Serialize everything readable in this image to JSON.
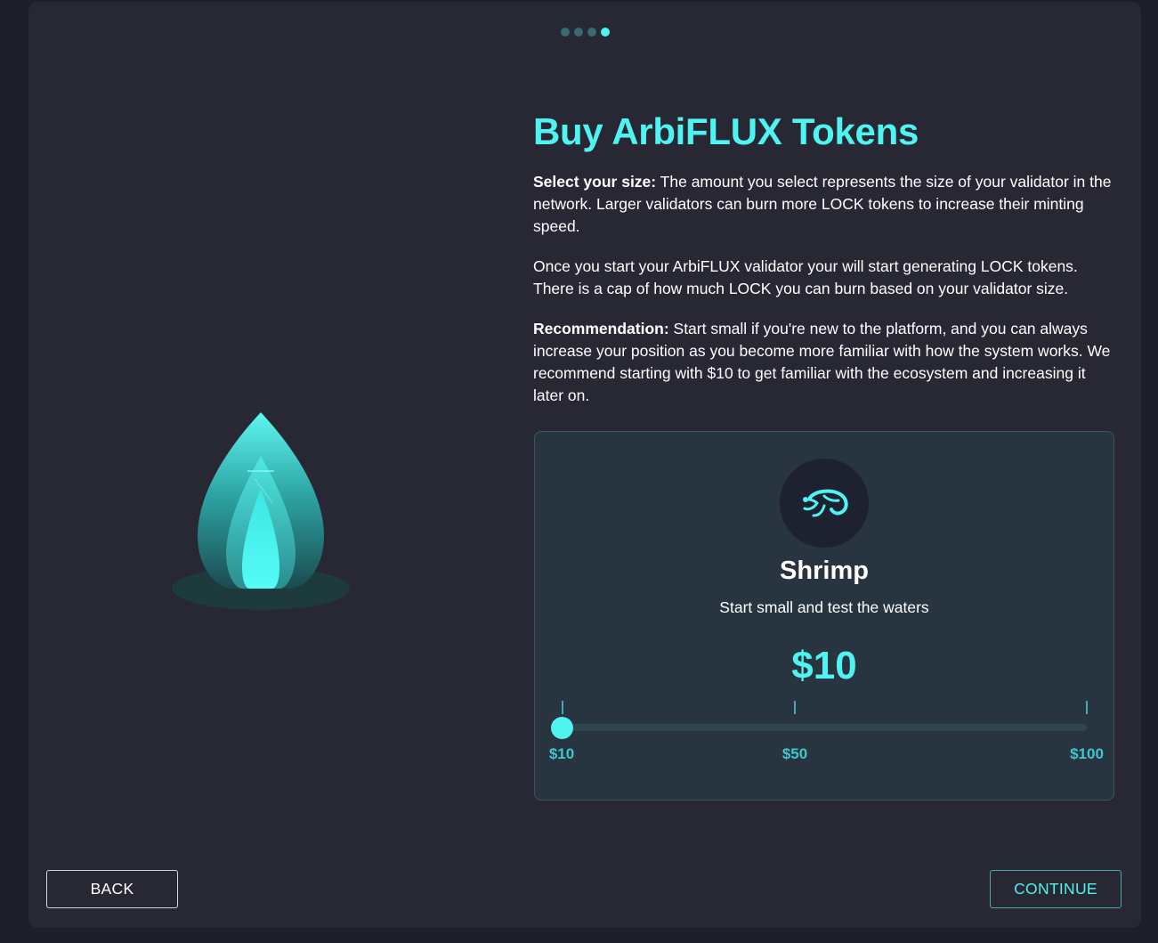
{
  "progress": {
    "total_steps": 4,
    "current_step": 4
  },
  "intro": {
    "title": "Buy ArbiFLUX Tokens",
    "size_label": "Select your size:",
    "size_text": " The amount you select represents the size of your validator in the network. Larger validators can burn more LOCK tokens to increase their minting speed.",
    "info_text": "Once you start your ArbiFLUX validator your will start generating LOCK tokens. There is a cap of how much LOCK you can burn based on your validator size.",
    "rec_label": "Recommendation:",
    "rec_text": " Start small if you're new to the platform, and you can always increase your position as you become more familiar with how the system works. We recommend starting with $10 to get familiar with the ecosystem and increasing it later on."
  },
  "tier": {
    "icon": "shrimp-icon",
    "name": "Shrimp",
    "description": "Start small and test the waters",
    "price": "$10"
  },
  "slider": {
    "min_label": "$10",
    "mid_label": "$50",
    "max_label": "$100",
    "value_fraction": 0
  },
  "buttons": {
    "back_label": "BACK",
    "continue_label": "CONTINUE"
  },
  "colors": {
    "accent": "#4ff3f0",
    "background": "#272834",
    "card": "#283440"
  }
}
